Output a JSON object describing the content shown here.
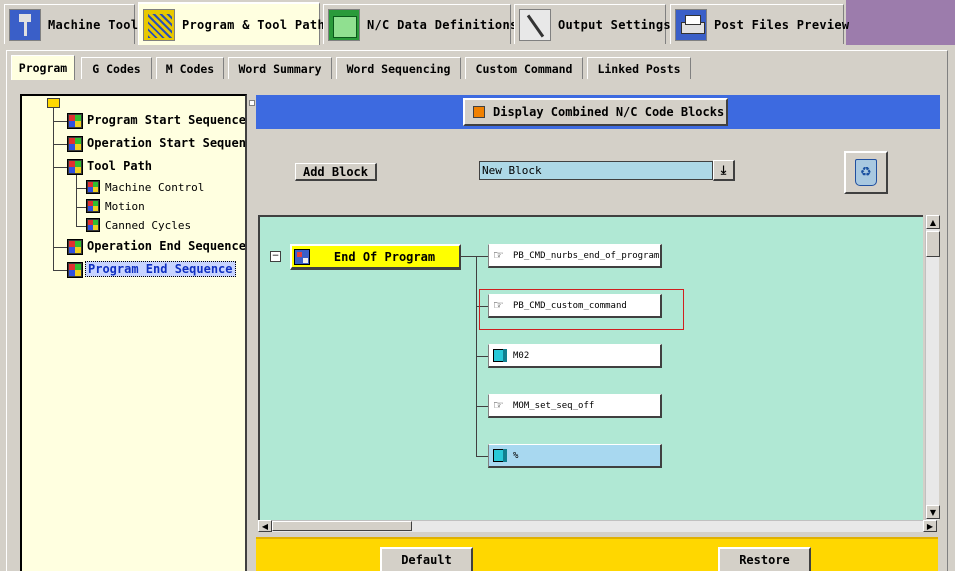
{
  "top_tabs": [
    {
      "label": "Machine Tool",
      "icon": "machine-tool-icon"
    },
    {
      "label": "Program & Tool Path",
      "icon": "program-icon"
    },
    {
      "label": "N/C Data Definitions",
      "icon": "nc-data-icon"
    },
    {
      "label": "Output Settings",
      "icon": "output-settings-icon"
    },
    {
      "label": "Post Files Preview",
      "icon": "printer-icon"
    }
  ],
  "active_top_tab": "Program & Tool Path",
  "sub_tabs": [
    "Program",
    "G Codes",
    "M Codes",
    "Word Summary",
    "Word Sequencing",
    "Custom Command",
    "Linked Posts"
  ],
  "active_sub_tab": "Program",
  "tree": {
    "items": [
      {
        "label": "Program Start Sequence",
        "bold": true
      },
      {
        "label": "Operation Start Sequence",
        "bold": true
      },
      {
        "label": "Tool Path",
        "bold": true
      },
      {
        "label": "Machine Control",
        "bold": false
      },
      {
        "label": "Motion",
        "bold": false
      },
      {
        "label": "Canned Cycles",
        "bold": false
      },
      {
        "label": "Operation End Sequence",
        "bold": true
      },
      {
        "label": "Program End Sequence",
        "bold": true,
        "selected": true
      }
    ]
  },
  "header": {
    "combined_label": "Display Combined N/C Code Blocks"
  },
  "toolbar": {
    "add_block_label": "Add Block",
    "block_select_value": "New Block",
    "dropdown_glyph": "⤓"
  },
  "canvas": {
    "collapse_glyph": "−",
    "event_label": "End Of Program",
    "blocks": [
      {
        "label": "PB_CMD_nurbs_end_of_program",
        "type": "command"
      },
      {
        "label": "PB_CMD_custom_command",
        "type": "command"
      },
      {
        "label": "M02",
        "type": "block"
      },
      {
        "label": "MOM_set_seq_off",
        "type": "command"
      },
      {
        "label": "%",
        "type": "block"
      }
    ]
  },
  "scroll": {
    "up": "▲",
    "down": "▼",
    "left": "◀",
    "right": "▶"
  },
  "bottom": {
    "default_label": "Default",
    "restore_label": "Restore"
  },
  "colors": {
    "canvas_bg": "#b0e8d4",
    "tree_bg": "#ffffe0",
    "header_blue": "#3d6ae0",
    "event_yellow": "#ffff00",
    "bottom_yellow": "#ffd700",
    "highlight_red": "#d02020"
  }
}
